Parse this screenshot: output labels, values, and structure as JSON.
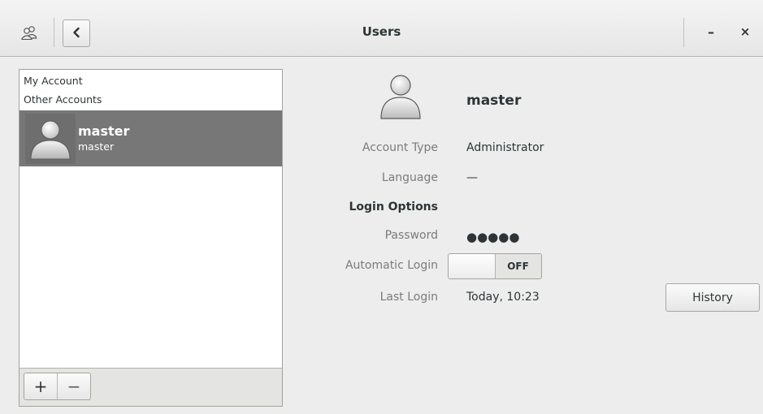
{
  "window": {
    "title": "Users",
    "minimize_label": "–",
    "close_label": "×"
  },
  "icons": {
    "app": "users-icon",
    "back": "chevron-left-icon",
    "avatar": "user-avatar-icon"
  },
  "sidebar": {
    "my_account_label": "My Account",
    "other_accounts_label": "Other Accounts",
    "users": [
      {
        "name": "master",
        "username": "master",
        "selected": true
      }
    ],
    "add_label": "+",
    "remove_label": "−"
  },
  "account": {
    "name": "master",
    "account_type_label": "Account Type",
    "account_type": "Administrator",
    "language_label": "Language",
    "language": "—",
    "login_options_label": "Login Options",
    "password_label": "Password",
    "password": "●●●●●",
    "automatic_login_label": "Automatic Login",
    "automatic_login_state": "OFF",
    "last_login_label": "Last Login",
    "last_login": "Today, 10:23",
    "history_label": "History"
  },
  "colors": {
    "background": "#ededed",
    "selection": "#777777",
    "text": "#2e3436",
    "dim_text": "#7b7b7b"
  }
}
